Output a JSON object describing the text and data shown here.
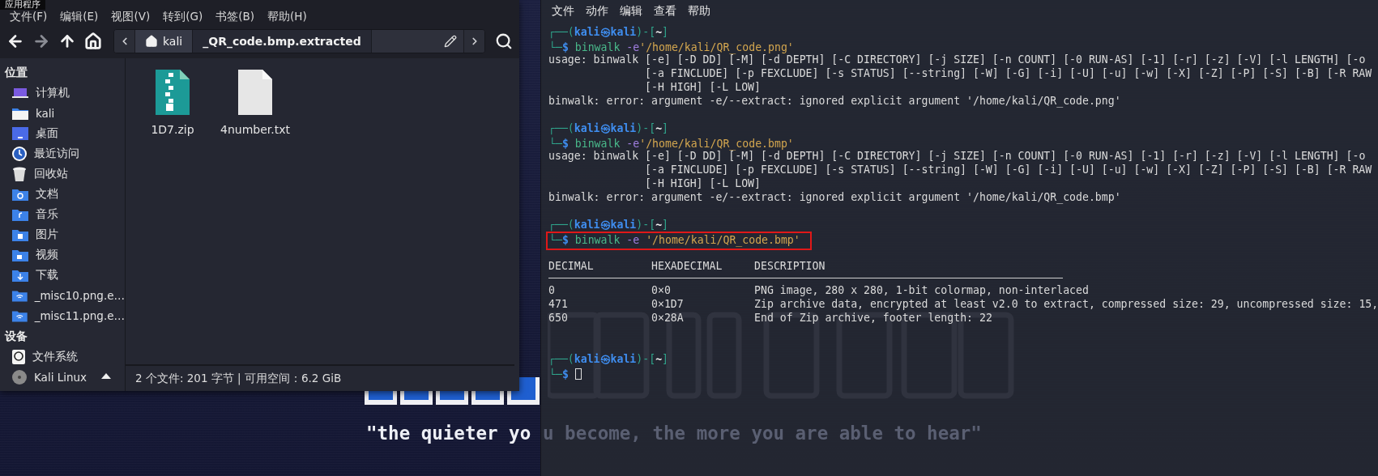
{
  "tooltip": {
    "label": "应用程序"
  },
  "file_manager": {
    "menu": [
      "文件(F)",
      "编辑(E)",
      "视图(V)",
      "转到(G)",
      "书签(B)",
      "帮助(H)"
    ],
    "nav_buttons": [
      {
        "kind": "back",
        "disabled": false
      },
      {
        "kind": "forward",
        "disabled": true
      },
      {
        "kind": "up",
        "disabled": false
      },
      {
        "kind": "home",
        "disabled": false
      }
    ],
    "path": [
      {
        "label": "kali",
        "kind": "home",
        "selected": false
      },
      {
        "label": "_QR_code.bmp.extracted",
        "kind": "folder",
        "selected": true
      }
    ],
    "sidebar": [
      {
        "title": "位置",
        "items": [
          {
            "label": "计算机",
            "kind": "computer"
          },
          {
            "label": "kali",
            "kind": "home"
          },
          {
            "label": "桌面",
            "kind": "desktop"
          },
          {
            "label": "最近访问",
            "kind": "recent"
          },
          {
            "label": "回收站",
            "kind": "trash"
          },
          {
            "label": "文档",
            "kind": "documents"
          },
          {
            "label": "音乐",
            "kind": "music"
          },
          {
            "label": "图片",
            "kind": "pictures"
          },
          {
            "label": "视频",
            "kind": "videos"
          },
          {
            "label": "下载",
            "kind": "downloads"
          },
          {
            "label": "_misc10.png.e…",
            "kind": "network"
          },
          {
            "label": "_misc11.png.e…",
            "kind": "network"
          }
        ]
      },
      {
        "title": "设备",
        "items": [
          {
            "label": "文件系统",
            "kind": "drive"
          },
          {
            "label": "Kali Linux",
            "kind": "disc",
            "ejectable": true
          }
        ]
      }
    ],
    "files": [
      {
        "name": "1D7.zip",
        "kind": "archive"
      },
      {
        "name": "4number.txt",
        "kind": "text"
      }
    ],
    "status": "2 个文件: 201 字节 | 可用空间：6.2 GiB"
  },
  "desktop": {
    "quote": "\"the quieter yo"
  },
  "terminal": {
    "menu": [
      "文件",
      "动作",
      "编辑",
      "查看",
      "帮助"
    ],
    "wallpaper": {
      "quote": "u become, the more you are able to hear\""
    },
    "blocks": [
      {
        "kind": "prompt",
        "open": "┌──(",
        "user": "kali",
        "at": "㉿",
        "host": "kali",
        "mid": ")-[",
        "dir": "~",
        "close": "]",
        "corner": "└─",
        "symbol": "$",
        "highlighted": false,
        "separated": false,
        "cursor": false,
        "command": "binwalk",
        "option": "-e",
        "argument": "'/home/kali/QR_code.png'"
      },
      {
        "kind": "output",
        "lines": [
          {
            "kind": "text",
            "text": "usage: binwalk [-e] [-D DD] [-M] [-d DEPTH] [-C DIRECTORY] [-j SIZE] [-n COUNT] [-0 RUN-AS] [-1] [-r] [-z] [-V] [-l LENGTH] [-o"
          },
          {
            "kind": "continuation",
            "text": "[-a FINCLUDE] [-p FEXCLUDE] [-s STATUS] [--string] [-W] [-G] [-i] [-U] [-u] [-w] [-X] [-Z] [-P] [-S] [-B] [-R RAW"
          },
          {
            "kind": "continuation",
            "text": "[-H HIGH] [-L LOW]"
          },
          {
            "kind": "text",
            "text": "binwalk: error: argument -e/--extract: ignored explicit argument '/home/kali/QR_code.png'"
          },
          {
            "kind": "blank"
          }
        ]
      },
      {
        "kind": "prompt",
        "open": "┌──(",
        "user": "kali",
        "at": "㉿",
        "host": "kali",
        "mid": ")-[",
        "dir": "~",
        "close": "]",
        "corner": "└─",
        "symbol": "$",
        "highlighted": false,
        "separated": false,
        "cursor": false,
        "command": "binwalk",
        "option": "-e",
        "argument": "'/home/kali/QR_code.bmp'"
      },
      {
        "kind": "output",
        "lines": [
          {
            "kind": "text",
            "text": "usage: binwalk [-e] [-D DD] [-M] [-d DEPTH] [-C DIRECTORY] [-j SIZE] [-n COUNT] [-0 RUN-AS] [-1] [-r] [-z] [-V] [-l LENGTH] [-o"
          },
          {
            "kind": "continuation",
            "text": "[-a FINCLUDE] [-p FEXCLUDE] [-s STATUS] [--string] [-W] [-G] [-i] [-U] [-u] [-w] [-X] [-Z] [-P] [-S] [-B] [-R RAW"
          },
          {
            "kind": "continuation",
            "text": "[-H HIGH] [-L LOW]"
          },
          {
            "kind": "text",
            "text": "binwalk: error: argument -e/--extract: ignored explicit argument '/home/kali/QR_code.bmp'"
          },
          {
            "kind": "blank"
          }
        ]
      },
      {
        "kind": "prompt",
        "open": "┌──(",
        "user": "kali",
        "at": "㉿",
        "host": "kali",
        "mid": ")-[",
        "dir": "~",
        "close": "]",
        "corner": "└─",
        "symbol": "$",
        "highlighted": true,
        "separated": true,
        "cursor": false,
        "command": "binwalk",
        "option": "-e",
        "argument": "'/home/kali/QR_code.bmp'"
      },
      {
        "kind": "output",
        "lines": [
          {
            "kind": "blank"
          }
        ]
      },
      {
        "kind": "table",
        "columns": [
          "DECIMAL",
          "HEXADECIMAL",
          "DESCRIPTION"
        ],
        "rows": [
          [
            "0",
            "0×0",
            "PNG image, 280 x 280, 1-bit colormap, non-interlaced"
          ],
          [
            "471",
            "0×1D7",
            "Zip archive data, encrypted at least v2.0 to extract, compressed size: 29, uncompressed size: 15,"
          ],
          [
            "650",
            "0×28A",
            "End of Zip archive, footer length: 22"
          ]
        ]
      },
      {
        "kind": "output",
        "lines": [
          {
            "kind": "blank"
          },
          {
            "kind": "blank"
          }
        ]
      },
      {
        "kind": "prompt",
        "open": "┌──(",
        "user": "kali",
        "at": "㉿",
        "host": "kali",
        "mid": ")-[",
        "dir": "~",
        "close": "]",
        "corner": "└─",
        "symbol": "$",
        "highlighted": false,
        "cursor": true
      }
    ]
  }
}
